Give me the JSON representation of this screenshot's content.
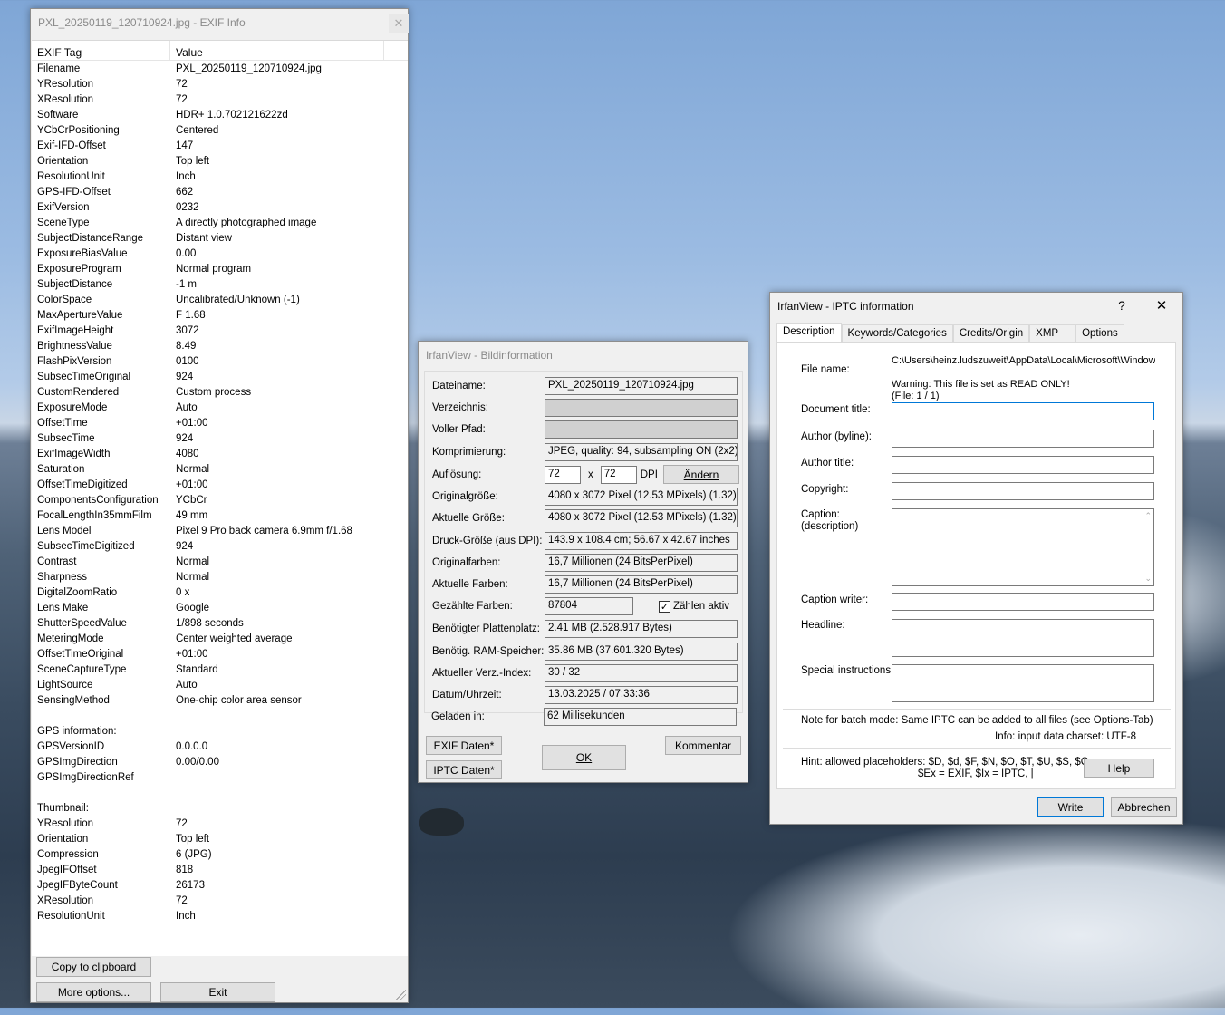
{
  "exif_window": {
    "title": "PXL_20250119_120710924.jpg - EXIF Info",
    "col_tag": "EXIF Tag",
    "col_value": "Value",
    "rows": [
      [
        "Filename",
        "PXL_20250119_120710924.jpg"
      ],
      [
        "YResolution",
        "72"
      ],
      [
        "XResolution",
        "72"
      ],
      [
        "Software",
        "HDR+ 1.0.702121622zd"
      ],
      [
        "YCbCrPositioning",
        "Centered"
      ],
      [
        "Exif-IFD-Offset",
        "147"
      ],
      [
        "Orientation",
        "Top left"
      ],
      [
        "ResolutionUnit",
        "Inch"
      ],
      [
        "GPS-IFD-Offset",
        "662"
      ],
      [
        "ExifVersion",
        "0232"
      ],
      [
        "SceneType",
        "A directly photographed image"
      ],
      [
        "SubjectDistanceRange",
        "Distant view"
      ],
      [
        "ExposureBiasValue",
        "0.00"
      ],
      [
        "ExposureProgram",
        "Normal program"
      ],
      [
        "SubjectDistance",
        "-1 m"
      ],
      [
        "ColorSpace",
        "Uncalibrated/Unknown (-1)"
      ],
      [
        "MaxApertureValue",
        "F 1.68"
      ],
      [
        "ExifImageHeight",
        "3072"
      ],
      [
        "BrightnessValue",
        "8.49"
      ],
      [
        "FlashPixVersion",
        "0100"
      ],
      [
        "SubsecTimeOriginal",
        "924"
      ],
      [
        "CustomRendered",
        "Custom process"
      ],
      [
        "ExposureMode",
        "Auto"
      ],
      [
        "OffsetTime",
        "+01:00"
      ],
      [
        "SubsecTime",
        "924"
      ],
      [
        "ExifImageWidth",
        "4080"
      ],
      [
        "Saturation",
        "Normal"
      ],
      [
        "OffsetTimeDigitized",
        "+01:00"
      ],
      [
        "ComponentsConfiguration",
        "YCbCr"
      ],
      [
        "FocalLengthIn35mmFilm",
        "49 mm"
      ],
      [
        "Lens Model",
        "Pixel 9 Pro back camera 6.9mm f/1.68"
      ],
      [
        "SubsecTimeDigitized",
        "924"
      ],
      [
        "Contrast",
        "Normal"
      ],
      [
        "Sharpness",
        "Normal"
      ],
      [
        "DigitalZoomRatio",
        "0 x"
      ],
      [
        "Lens Make",
        "Google"
      ],
      [
        "ShutterSpeedValue",
        "1/898 seconds"
      ],
      [
        "MeteringMode",
        "Center weighted average"
      ],
      [
        "OffsetTimeOriginal",
        "+01:00"
      ],
      [
        "SceneCaptureType",
        "Standard"
      ],
      [
        "LightSource",
        "Auto"
      ],
      [
        "SensingMethod",
        "One-chip color area sensor"
      ],
      [
        "",
        ""
      ],
      [
        "GPS information:",
        ""
      ],
      [
        "GPSVersionID",
        "0.0.0.0"
      ],
      [
        "GPSImgDirection",
        "0.00/0.00"
      ],
      [
        "GPSImgDirectionRef",
        ""
      ],
      [
        "",
        ""
      ],
      [
        "Thumbnail:",
        ""
      ],
      [
        "YResolution",
        "72"
      ],
      [
        "Orientation",
        "Top left"
      ],
      [
        "Compression",
        "6 (JPG)"
      ],
      [
        "JpegIFOffset",
        "818"
      ],
      [
        "JpegIFByteCount",
        "26173"
      ],
      [
        "XResolution",
        "72"
      ],
      [
        "ResolutionUnit",
        "Inch"
      ]
    ],
    "copy_button": "Copy to clipboard",
    "more_button": "More options...",
    "exit_button": "Exit"
  },
  "info_window": {
    "title": "IrfanView - Bildinformation",
    "labels": {
      "dateiname": "Dateiname:",
      "verzeichnis": "Verzeichnis:",
      "voller_pfad": "Voller Pfad:",
      "komprimierung": "Komprimierung:",
      "aufloesung": "Auflösung:",
      "originalgroesse": "Originalgröße:",
      "aktuelle_groesse": "Aktuelle Größe:",
      "druck_groesse": "Druck-Größe (aus DPI):",
      "originalfarben": "Originalfarben:",
      "aktuelle_farben": "Aktuelle Farben:",
      "gezaehlte_farben": "Gezählte Farben:",
      "plattenplatz": "Benötigter Plattenplatz:",
      "ram": "Benötig. RAM-Speicher:",
      "verz_index": "Aktueller Verz.-Index:",
      "datum": "Datum/Uhrzeit:",
      "geladen": "Geladen in:"
    },
    "values": {
      "dateiname": "PXL_20250119_120710924.jpg",
      "komprimierung": "JPEG, quality: 94, subsampling ON (2x2)",
      "dpi_x": "72",
      "dpi_sep": "x",
      "dpi_y": "72",
      "dpi_unit": "DPI",
      "originalgroesse": "4080 x 3072  Pixel (12.53 MPixels) (1.32)",
      "aktuelle_groesse": "4080 x 3072  Pixel (12.53 MPixels) (1.32)",
      "druck_groesse": "143.9 x 108.4 cm; 56.67 x 42.67 inches",
      "originalfarben": "16,7 Millionen   (24 BitsPerPixel)",
      "aktuelle_farben": "16,7 Millionen   (24 BitsPerPixel)",
      "gezaehlte_farben": "87804",
      "plattenplatz": "2.41 MB (2.528.917 Bytes)",
      "ram": "35.86  MB (37.601.320 Bytes)",
      "verz_index": "30  /  32",
      "datum": "13.03.2025 / 07:33:36",
      "geladen": "62 Millisekunden"
    },
    "andern_button": "Ändern",
    "zaehlen_label": "Zählen aktiv",
    "exif_button": "EXIF Daten*",
    "iptc_button": "IPTC Daten*",
    "ok_button": "OK",
    "kommentar_button": "Kommentar"
  },
  "iptc_window": {
    "title": "IrfanView - IPTC information",
    "help_glyph": "?",
    "tabs": [
      "Description",
      "Keywords/Categories",
      "Credits/Origin",
      "XMP",
      "Options"
    ],
    "file_name_label": "File name:",
    "file_path": "C:\\Users\\heinz.ludszuweit\\AppData\\Local\\Microsoft\\Window",
    "warning": "Warning: This file is set as READ ONLY!",
    "file_count": "(File: 1 / 1)",
    "document_title": "Document title:",
    "author_byline": "Author (byline):",
    "author_title": "Author title:",
    "copyright": "Copyright:",
    "caption": "Caption:",
    "caption_sub": "(description)",
    "caption_writer": "Caption writer:",
    "headline": "Headline:",
    "special_instructions": "Special instructions:",
    "batch_note": "Note for batch mode: Same IPTC can be added to all files (see Options-Tab)",
    "charset_info": "Info: input data charset: UTF-8",
    "hint_line1": "Hint: allowed placeholders: $D, $d, $F, $N, $O, $T, $U, $S, $C,",
    "hint_line2": "$Ex = EXIF, $Ix = IPTC, |",
    "help_button": "Help",
    "write_button": "Write",
    "cancel_button": "Abbrechen"
  }
}
